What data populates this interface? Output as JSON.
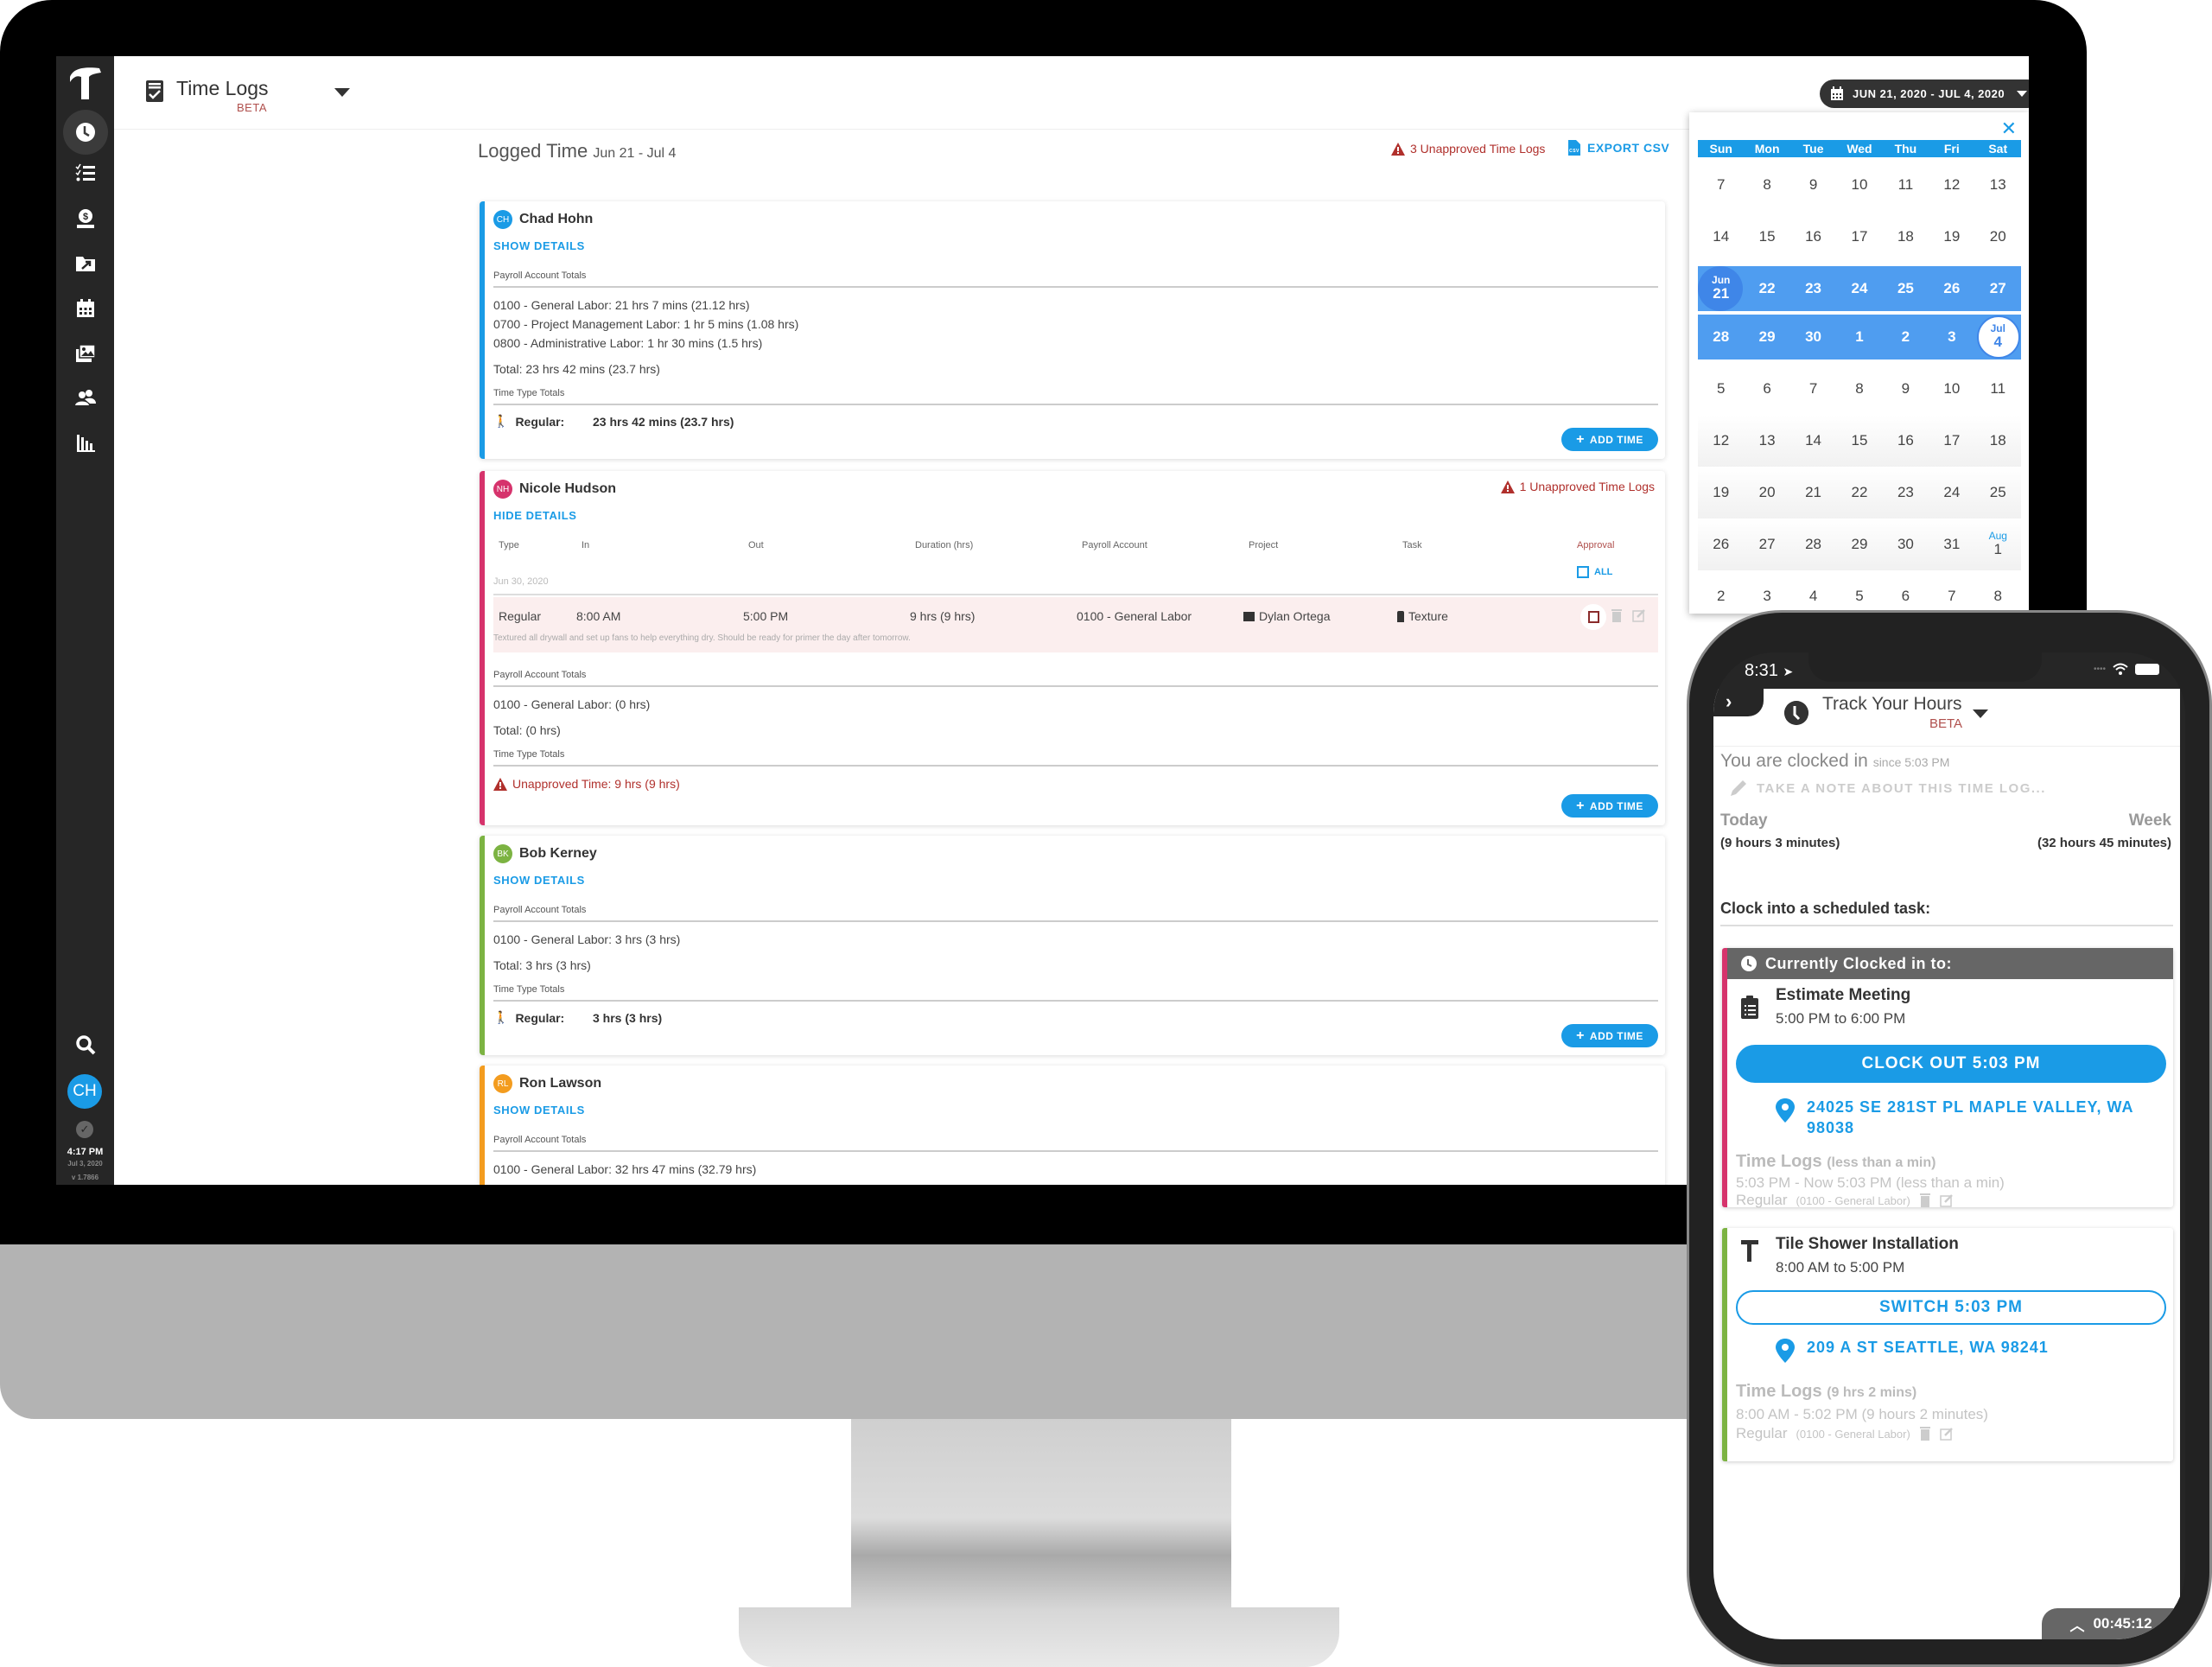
{
  "app": {
    "title": "Time Logs",
    "beta": "BETA",
    "date_range_button": "JUN 21, 2020 - JUL 4, 2020"
  },
  "sidebar": {
    "items": [
      {
        "name": "time",
        "icon": "clock-icon",
        "active": true
      },
      {
        "name": "tasks",
        "icon": "checklist-icon"
      },
      {
        "name": "financials",
        "icon": "money-bag-icon"
      },
      {
        "name": "projects",
        "icon": "folder-arrow-icon"
      },
      {
        "name": "calendar",
        "icon": "calendar-icon"
      },
      {
        "name": "photos",
        "icon": "images-icon"
      },
      {
        "name": "contacts",
        "icon": "users-icon"
      },
      {
        "name": "reports",
        "icon": "bar-chart-icon"
      }
    ],
    "user_initials": "CH",
    "clock_time": "4:17 PM",
    "clock_date": "Jul 3, 2020",
    "version": "v 1.7866"
  },
  "main": {
    "title": "Logged Time",
    "title_range": "Jun 21 - Jul 4",
    "unapproved_link": "3 Unapproved Time Logs",
    "export_label": "EXPORT CSV",
    "labels": {
      "payroll_totals": "Payroll Account Totals",
      "time_type_totals": "Time Type Totals",
      "add_time": "ADD TIME",
      "show_details": "SHOW DETAILS",
      "hide_details": "HIDE DETAILS"
    },
    "employees": [
      {
        "name": "Chad Hohn",
        "initials": "CH",
        "color": "#1a9be6",
        "details_toggle": "SHOW DETAILS",
        "payroll_lines": [
          "0100 - General Labor: 21 hrs 7 mins (21.12 hrs)",
          "0700 - Project Management Labor: 1 hr 5 mins (1.08 hrs)",
          "0800 - Administrative Labor: 1 hr 30 mins (1.5 hrs)"
        ],
        "total": "Total: 23 hrs 42 mins (23.7 hrs)",
        "regular_label": "Regular:",
        "regular_value": "23 hrs 42 mins (23.7 hrs)"
      },
      {
        "name": "Nicole Hudson",
        "initials": "NH",
        "color": "#d6336c",
        "details_toggle": "HIDE DETAILS",
        "warning": "1 Unapproved Time Logs",
        "table": {
          "headers": [
            "Type",
            "In",
            "Out",
            "Duration (hrs)",
            "Payroll Account",
            "Project",
            "Task",
            "Approval"
          ],
          "approve_all_label": "ALL",
          "date": "Jun 30, 2020",
          "row": {
            "type": "Regular",
            "in": "8:00 AM",
            "out": "5:00 PM",
            "duration": "9 hrs (9 hrs)",
            "payroll_account": "0100 - General Labor",
            "project": "Dylan Ortega",
            "task": "Texture",
            "approved": false,
            "note": "Textured all drywall and set up fans to help everything dry. Should be ready for primer the day after tomorrow."
          }
        },
        "payroll_lines": [
          "0100 - General Labor: (0 hrs)"
        ],
        "total": "Total: (0 hrs)",
        "unapproved_time": "Unapproved Time: 9 hrs (9 hrs)"
      },
      {
        "name": "Bob Kerney",
        "initials": "BK",
        "color": "#7cb342",
        "details_toggle": "SHOW DETAILS",
        "payroll_lines": [
          "0100 - General Labor: 3 hrs (3 hrs)"
        ],
        "total": "Total: 3 hrs (3 hrs)",
        "regular_label": "Regular:",
        "regular_value": "3 hrs (3 hrs)"
      },
      {
        "name": "Ron Lawson",
        "initials": "RL",
        "color": "#f39c1f",
        "details_toggle": "SHOW DETAILS",
        "payroll_lines": [
          "0100 - General Labor: 32 hrs 47 mins (32.79 hrs)"
        ]
      }
    ]
  },
  "calendar": {
    "weekdays": [
      "Sun",
      "Mon",
      "Tue",
      "Wed",
      "Thu",
      "Fri",
      "Sat"
    ],
    "weeks": [
      [
        "7",
        "8",
        "9",
        "10",
        "11",
        "12",
        "13"
      ],
      [
        "14",
        "15",
        "16",
        "17",
        "18",
        "19",
        "20"
      ],
      [
        "21",
        "22",
        "23",
        "24",
        "25",
        "26",
        "27"
      ],
      [
        "28",
        "29",
        "30",
        "1",
        "2",
        "3",
        "4"
      ],
      [
        "5",
        "6",
        "7",
        "8",
        "9",
        "10",
        "11"
      ],
      [
        "12",
        "13",
        "14",
        "15",
        "16",
        "17",
        "18"
      ],
      [
        "19",
        "20",
        "21",
        "22",
        "23",
        "24",
        "25"
      ],
      [
        "26",
        "27",
        "28",
        "29",
        "30",
        "31",
        "1"
      ],
      [
        "2",
        "3",
        "4",
        "5",
        "6",
        "7",
        "8"
      ]
    ],
    "range_start": {
      "month": "Jun",
      "day": "21"
    },
    "range_end": {
      "month": "Jul",
      "day": "4"
    },
    "aug_label": "Aug"
  },
  "phone": {
    "status_time": "8:31",
    "title": "Track Your Hours",
    "beta": "BETA",
    "clocked_in": "You are clocked in",
    "clocked_since": "since 5:03 PM",
    "note_placeholder": "TAKE A NOTE ABOUT THIS TIME LOG...",
    "today_label": "Today",
    "today_value": "(9 hours 3 minutes)",
    "week_label": "Week",
    "week_value": "(32 hours 45 minutes)",
    "scheduled_heading": "Clock into a scheduled task:",
    "current": {
      "header": "Currently Clocked in to:",
      "task": "Estimate Meeting",
      "time": "5:00 PM to 6:00 PM",
      "button": "CLOCK OUT  5:03 PM",
      "address": "24025 SE 281ST PL MAPLE VALLEY, WA 98038",
      "logs_title": "Time Logs",
      "logs_summary": "(less than a min)",
      "log_line": "5:03 PM - Now 5:03 PM (less than a min)",
      "log_type": "Regular",
      "log_account": "(0100 - General Labor)"
    },
    "next": {
      "task": "Tile Shower Installation",
      "time": "8:00 AM to 5:00 PM",
      "button": "SWITCH  5:03 PM",
      "address": "209 A ST SEATTLE, WA 98241",
      "logs_title": "Time Logs",
      "logs_summary": "(9 hrs 2 mins)",
      "log_line": "8:00 AM - 5:02 PM (9 hours 2 minutes)",
      "log_type": "Regular",
      "log_account": "(0100 - General Labor)"
    },
    "timer": "00:45:12"
  }
}
